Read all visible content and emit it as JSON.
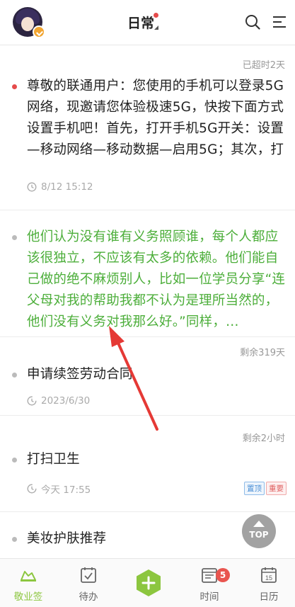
{
  "header": {
    "title": "日常",
    "title_has_unread_dot": true,
    "avatar": "user-avatar",
    "actions": [
      "search-icon",
      "menu-icon"
    ]
  },
  "notes": [
    {
      "status": "已超时2天",
      "bullet_color": "#e54b4b",
      "text": "尊敬的联通用户：您使用的手机可以登录5G网络，现邀请您体验极速5G，快按下面方式设置手机吧！首先，打开手机5G开关：设置—移动网络—移动数据—启用5G；其次，打开手机SA开关：优先将手机系统更新至最…",
      "time": "8/12 15:12",
      "text_color": "#222222"
    },
    {
      "status": "",
      "bullet_color": "#bbbbbb",
      "text": "他们认为没有谁有义务照顾谁，每个人都应该很独立，不应该有太多的依赖。他们能自己做的绝不麻烦别人，比如一位学员分享“连父母对我的帮助我都不认为是理所当然的，他们没有义务对我那么好。”同样，…",
      "time": "",
      "text_color": "#4cae3a"
    },
    {
      "status": "剩余319天",
      "bullet_color": "#bbbbbb",
      "text": "申请续签劳动合同",
      "time": "2023/6/30",
      "text_color": "#222222"
    },
    {
      "status": "剩余2小时",
      "bullet_color": "#bbbbbb",
      "text": "打扫卫生",
      "time": "今天 17:55",
      "tags": [
        "置顶",
        "重要"
      ],
      "text_color": "#222222"
    },
    {
      "status": "",
      "bullet_color": "#bbbbbb",
      "text": "美妆护肤推荐",
      "time": "",
      "text_color": "#222222"
    }
  ],
  "top_button": {
    "label": "TOP"
  },
  "bottom_nav": {
    "items": [
      {
        "label": "敬业签",
        "icon": "notes-cloud-icon",
        "active": true
      },
      {
        "label": "待办",
        "icon": "todo-check-icon",
        "active": false
      },
      {
        "label": "",
        "icon": "add-icon",
        "active": false
      },
      {
        "label": "时间",
        "icon": "time-calendar-icon",
        "active": false,
        "badge": "5"
      },
      {
        "label": "日历",
        "icon": "calendar-icon",
        "active": false,
        "day": "15"
      }
    ]
  },
  "colors": {
    "accent_green": "#8cc63f",
    "note_green": "#4cae3a",
    "alert_red": "#e54b4b",
    "annotation_arrow": "#e53935"
  }
}
